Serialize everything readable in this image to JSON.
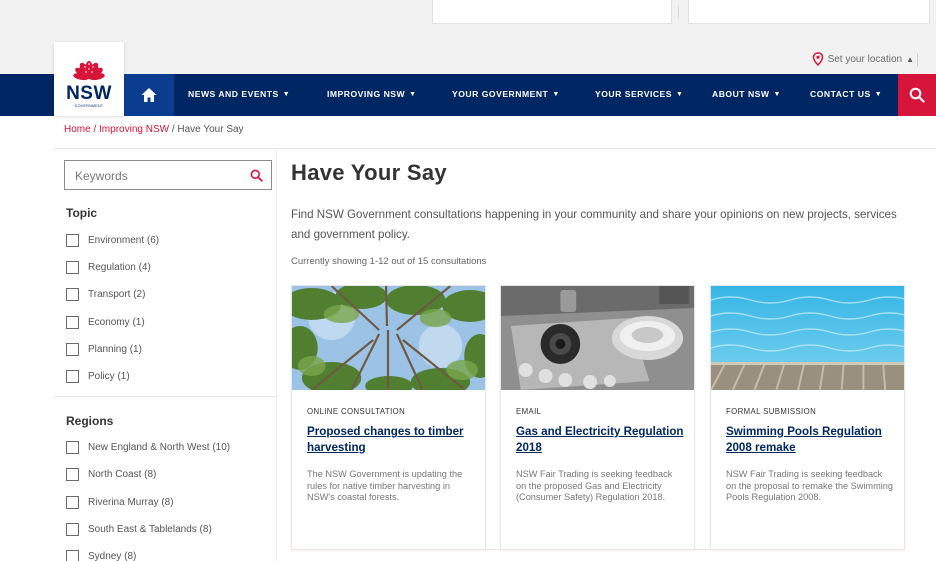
{
  "location": {
    "label": "Set your location"
  },
  "logo": {
    "brand": "NSW",
    "tagline": "GOVERNMENT"
  },
  "nav": {
    "items": [
      {
        "label": "NEWS AND EVENTS"
      },
      {
        "label": "IMPROVING NSW"
      },
      {
        "label": "YOUR GOVERNMENT"
      },
      {
        "label": "YOUR SERVICES"
      },
      {
        "label": "ABOUT NSW"
      },
      {
        "label": "CONTACT US"
      }
    ]
  },
  "breadcrumb": {
    "home": "Home",
    "section": "Improving NSW",
    "current": "Have Your Say",
    "sep": " / "
  },
  "sidebar": {
    "search_placeholder": "Keywords",
    "topic_title": "Topic",
    "topics": [
      {
        "label": "Environment (6)"
      },
      {
        "label": "Regulation (4)"
      },
      {
        "label": "Transport (2)"
      },
      {
        "label": "Economy (1)"
      },
      {
        "label": "Planning (1)"
      },
      {
        "label": "Policy (1)"
      }
    ],
    "regions_title": "Regions",
    "regions": [
      {
        "label": "New England & North West (10)"
      },
      {
        "label": "North Coast (8)"
      },
      {
        "label": "Riverina Murray (8)"
      },
      {
        "label": "South East & Tablelands (8)"
      },
      {
        "label": "Sydney (8)"
      }
    ]
  },
  "main": {
    "title": "Have Your Say",
    "intro": "Find NSW Government consultations happening in your community and share your opinions on new projects, services and government policy.",
    "showing": "Currently showing 1-12 out of 15 consultations",
    "cards": [
      {
        "type": "ONLINE CONSULTATION",
        "title": "Proposed changes to timber harvesting",
        "description": "The NSW Government is updating the rules for native timber harvesting in NSW's coastal forests."
      },
      {
        "type": "EMAIL",
        "title": "Gas and Electricity Regulation 2018",
        "description": "NSW Fair Trading is seeking feedback on the proposed Gas and Electricity (Consumer Safety) Regulation 2018."
      },
      {
        "type": "FORMAL SUBMISSION",
        "title": "Swimming Pools Regulation 2008 remake",
        "description": "NSW Fair Trading is seeking feedback on the proposal to remake the Swimming Pools Regulation 2008."
      }
    ]
  },
  "colors": {
    "navy": "#002664",
    "red": "#d7153a",
    "home_blue": "#0a3d8f"
  }
}
